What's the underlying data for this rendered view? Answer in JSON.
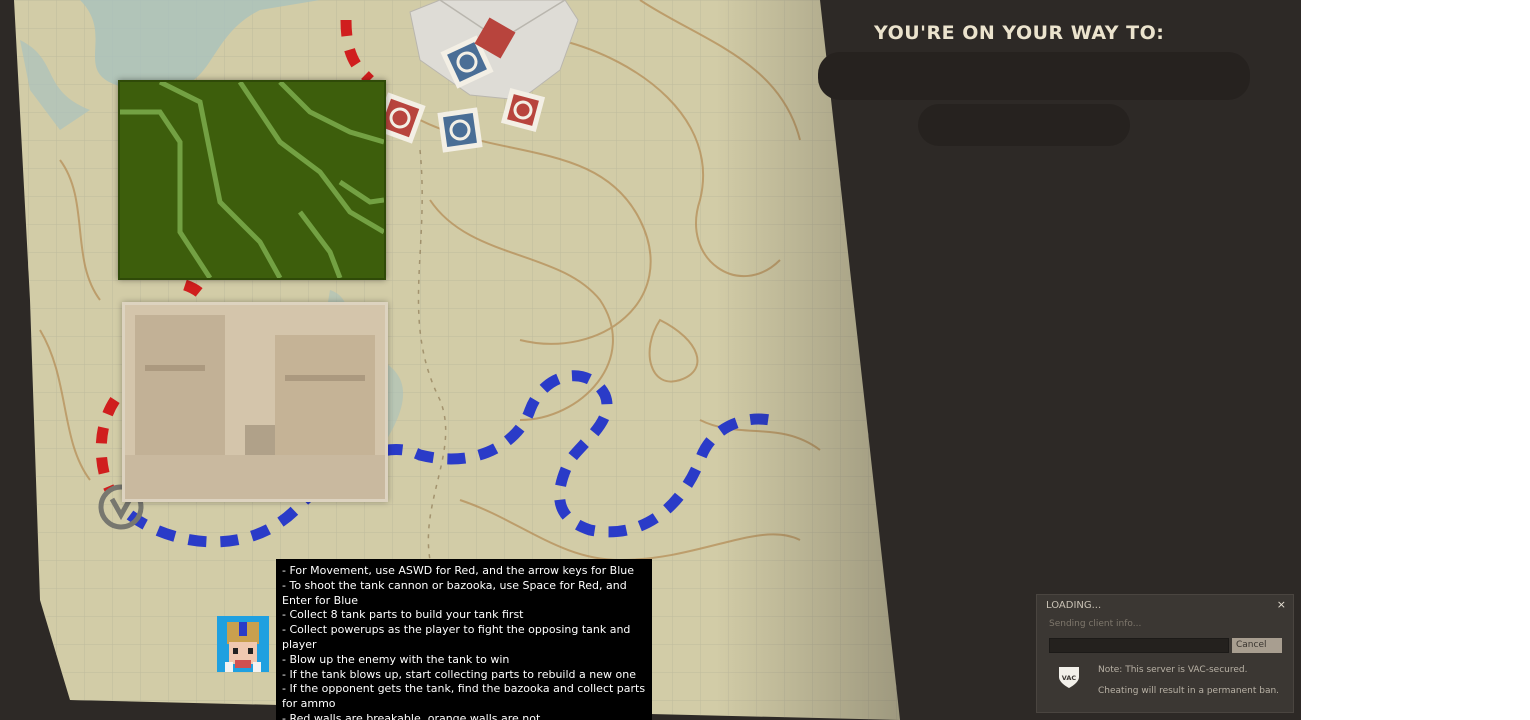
{
  "header": {
    "title": "YOU'RE ON YOUR WAY TO:"
  },
  "instructions": {
    "lines": [
      "- For Movement, use ASWD for Red, and the arrow keys for Blue",
      "- To shoot the tank cannon or bazooka, use Space for Red, and Enter for Blue",
      "- Collect 8 tank parts to build your tank first",
      "- Collect powerups as the player to fight the opposing tank and player",
      "- Blow up the enemy with the tank to win",
      "- If the tank blows up, start collecting parts to rebuild a new one",
      "- If the opponent gets the tank, find the bazooka and collect parts for ammo",
      "- Red walls are breakable, orange walls are not"
    ]
  },
  "loading_dialog": {
    "title": "LOADING...",
    "close_label": "×",
    "status": "Sending client info...",
    "progress": 0,
    "cancel_label": "Cancel",
    "vac_badge": "VAC",
    "note": "Note: This server is VAC-secured.",
    "warning": "Cheating will result in a permanent ban."
  },
  "icons": {
    "team_stamp": "team-stamp-icon",
    "close": "close-icon",
    "vac_shield": "vac-shield-icon",
    "spawn_marker": "spawn-marker-icon"
  },
  "colors": {
    "red_team": "#d01e1e",
    "blue_team": "#2a3bc8",
    "map_paper": "#cfc9a4",
    "background": "#2d2926",
    "heading_text": "#ebe3cd"
  }
}
